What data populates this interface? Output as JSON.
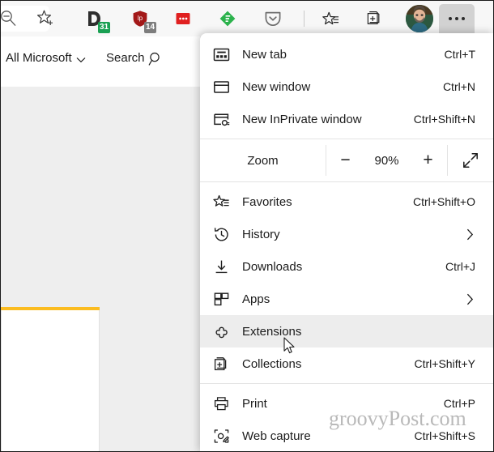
{
  "toolbar": {
    "icons": [
      {
        "name": "zoom-out-icon",
        "label": "Zoom out"
      },
      {
        "name": "add-favorite-icon",
        "label": "Add this page to favorites"
      },
      {
        "name": "extension-dashlane-icon",
        "label": "Dashlane",
        "badge": "31"
      },
      {
        "name": "extension-lastpass-icon",
        "label": "LastPass",
        "badge": "14"
      },
      {
        "name": "extension-red-icon",
        "label": "Extension"
      },
      {
        "name": "extension-feedly-icon",
        "label": "Feedly"
      },
      {
        "name": "extension-pocket-icon",
        "label": "Pocket"
      },
      {
        "name": "favorites-icon",
        "label": "Favorites"
      },
      {
        "name": "collections-icon",
        "label": "Collections"
      },
      {
        "name": "profile-avatar",
        "label": "Profile"
      },
      {
        "name": "settings-and-more-button",
        "label": "Settings and more"
      }
    ],
    "badges": {
      "dashlane": "31",
      "lastpass": "14"
    }
  },
  "page": {
    "all_microsoft": "All Microsoft",
    "search": "Search",
    "accent_color": "#fbbc21"
  },
  "menu": {
    "groups": [
      {
        "items": [
          {
            "label": "New tab",
            "accel": "Ctrl+T",
            "icon": "new-tab-icon",
            "submenu": false
          },
          {
            "label": "New window",
            "accel": "Ctrl+N",
            "icon": "new-window-icon",
            "submenu": false
          },
          {
            "label": "New InPrivate window",
            "accel": "Ctrl+Shift+N",
            "icon": "inprivate-icon",
            "submenu": false
          }
        ]
      },
      {
        "items": [
          {
            "label": "Favorites",
            "accel": "Ctrl+Shift+O",
            "icon": "favorites-star-icon",
            "submenu": false
          },
          {
            "label": "History",
            "accel": "",
            "icon": "history-icon",
            "submenu": true
          },
          {
            "label": "Downloads",
            "accel": "Ctrl+J",
            "icon": "downloads-icon",
            "submenu": false
          },
          {
            "label": "Apps",
            "accel": "",
            "icon": "apps-icon",
            "submenu": true
          },
          {
            "label": "Extensions",
            "accel": "",
            "icon": "extensions-puzzle-icon",
            "submenu": false,
            "hovered": true
          },
          {
            "label": "Collections",
            "accel": "Ctrl+Shift+Y",
            "icon": "collections-stack-icon",
            "submenu": false
          }
        ]
      },
      {
        "items": [
          {
            "label": "Print",
            "accel": "Ctrl+P",
            "icon": "printer-icon",
            "submenu": false
          },
          {
            "label": "Web capture",
            "accel": "Ctrl+Shift+S",
            "icon": "web-capture-icon",
            "submenu": false
          }
        ]
      }
    ],
    "zoom": {
      "label": "Zoom",
      "minus": "−",
      "value": "90%",
      "plus": "+",
      "fullscreen_name": "fullscreen-icon"
    }
  },
  "watermark": "groovyPost.com"
}
